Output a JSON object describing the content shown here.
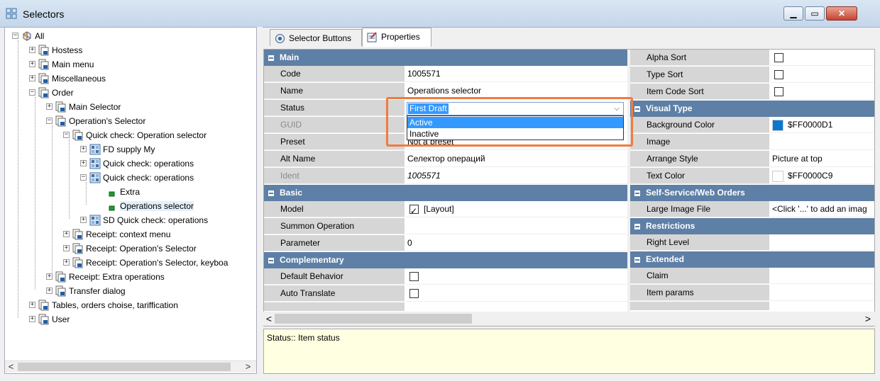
{
  "window": {
    "title": "Selectors",
    "app_icon": "grid-icon",
    "minimize_icon": "minimize-icon",
    "maximize_icon": "maximize-icon",
    "close_icon": "close-icon"
  },
  "tree": {
    "items": [
      {
        "label": "All",
        "icon": "world-icon",
        "expander": "⊟"
      },
      {
        "label": "Hostess",
        "icon": "folder-icon",
        "expander": "⊞"
      },
      {
        "label": "Main menu",
        "icon": "folder-icon",
        "expander": "⊞"
      },
      {
        "label": "Miscellaneous",
        "icon": "folder-icon",
        "expander": "⊞"
      },
      {
        "label": "Order",
        "icon": "folder-icon",
        "expander": "⊟"
      },
      {
        "label": "Main Selector",
        "icon": "folder-icon",
        "expander": "⊞"
      },
      {
        "label": "Operation's Selector",
        "icon": "folder-icon",
        "expander": "⊟"
      },
      {
        "label": "Quick check: Operation selector",
        "icon": "folder-icon",
        "expander": "⊟"
      },
      {
        "label": "FD supply My",
        "icon": "selector-icon",
        "expander": "⊞"
      },
      {
        "label": "Quick check: operations",
        "icon": "selector-icon",
        "expander": "⊞"
      },
      {
        "label": "Quick check: operations",
        "icon": "selector-icon",
        "expander": "⊟"
      },
      {
        "label": "Extra",
        "icon": "button-icon",
        "expander": ""
      },
      {
        "label": "Operations selector",
        "icon": "button-icon",
        "expander": ""
      },
      {
        "label": "SD Quick check: operations",
        "icon": "selector-icon",
        "expander": "⊞"
      },
      {
        "label": "Receipt: context menu",
        "icon": "folder-icon",
        "expander": "⊞"
      },
      {
        "label": "Receipt: Operation's Selector",
        "icon": "folder-icon",
        "expander": "⊞"
      },
      {
        "label": "Receipt: Operation's Selector, keyboa",
        "icon": "folder-icon",
        "expander": "⊞"
      },
      {
        "label": "Receipt: Extra operations",
        "icon": "folder-icon",
        "expander": "⊞"
      },
      {
        "label": "Transfer dialog",
        "icon": "folder-icon",
        "expander": "⊞"
      },
      {
        "label": "Tables, orders choise, tariffication",
        "icon": "folder-icon",
        "expander": "⊞"
      },
      {
        "label": "User",
        "icon": "folder-icon",
        "expander": "⊞"
      }
    ],
    "scroll_left": "<",
    "scroll_right": ">"
  },
  "tabs": [
    {
      "label": "Selector Buttons",
      "icon": "selector-buttons-icon",
      "active": false
    },
    {
      "label": "Properties",
      "icon": "properties-icon",
      "active": true
    }
  ],
  "left_grid": {
    "cat_main": "Main",
    "code_k": "Code",
    "code_v": "1005571",
    "name_k": "Name",
    "name_v": "Operations selector",
    "status_k": "Status",
    "status_v": "First Draft",
    "guid_k": "GUID",
    "preset_k": "Preset",
    "preset_v": "Not a preset",
    "altname_k": "Alt Name",
    "altname_v": "Селектор операций",
    "ident_k": "Ident",
    "ident_v": "1005571",
    "cat_basic": "Basic",
    "model_k": "Model",
    "model_v": "[Layout]",
    "summon_k": "Summon Operation",
    "param_k": "Parameter",
    "param_v": "0",
    "cat_comp": "Complementary",
    "defbeh_k": "Default Behavior",
    "autotr_k": "Auto Translate"
  },
  "right_grid": {
    "alpha_k": "Alpha Sort",
    "type_k": "Type Sort",
    "itemcode_k": "Item Code Sort",
    "cat_visual": "Visual Type",
    "bg_k": "Background Color",
    "bg_v": "$FF0000D1",
    "bg_color": "#0a78d1",
    "image_k": "Image",
    "arrange_k": "Arrange Style",
    "arrange_v": "Picture at top",
    "textcolor_k": "Text Color",
    "textcolor_v": "$FF0000C9",
    "textcolor_color": "#ffffff",
    "cat_self": "Self-Service/Web Orders",
    "large_k": "Large Image File",
    "large_v": "<Click '...' to add an imag",
    "cat_restr": "Restrictions",
    "right_k": "Right Level",
    "cat_ext": "Extended",
    "claim_k": "Claim",
    "itemparams_k": "Item params"
  },
  "dropdown": {
    "options": [
      "Active",
      "Inactive"
    ],
    "highlighted": "Active"
  },
  "grid_scroll": {
    "left": "<",
    "right": ">"
  },
  "description": "Status:: Item status"
}
